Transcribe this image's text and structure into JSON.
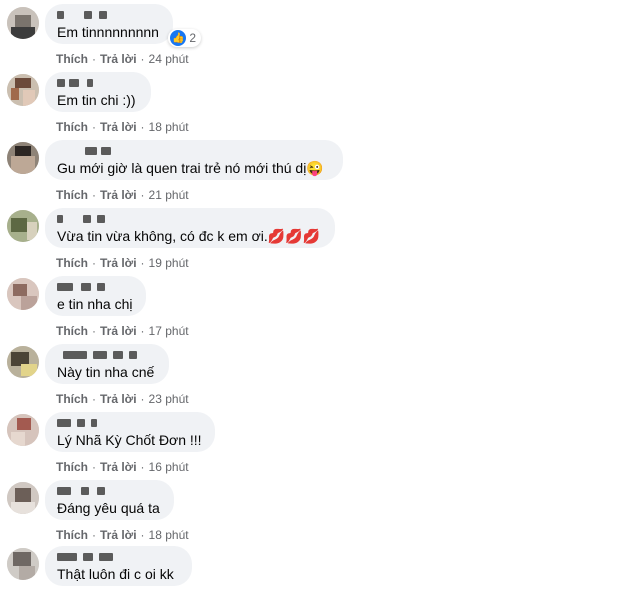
{
  "comments": [
    {
      "text": "Em tinnnnnnnnn",
      "reaction_count": "2",
      "reaction_icon": "like-icon",
      "time": "24 phút"
    },
    {
      "text": "Em tin chi :))",
      "time": "18 phút"
    },
    {
      "text": "Gu mới giờ là quen trai trẻ nó mới thú dị😜",
      "time": "21 phút"
    },
    {
      "text": "Vừa tin vừa không, có đc k em ơi.💋💋💋",
      "time": "19 phút"
    },
    {
      "text": "e tin nha chị",
      "time": "17 phút"
    },
    {
      "text": "Này tin nha cnế",
      "time": "23 phút"
    },
    {
      "text": "Lý Nhã Kỳ Chốt Đơn !!!",
      "time": "16 phút"
    },
    {
      "text": "Đáng yêu quá ta",
      "time": "18 phút"
    },
    {
      "text": "Thật luôn đi c oi kk",
      "time": ""
    }
  ],
  "actions": {
    "like": "Thích",
    "reply": "Trả lời",
    "separator": "·"
  }
}
